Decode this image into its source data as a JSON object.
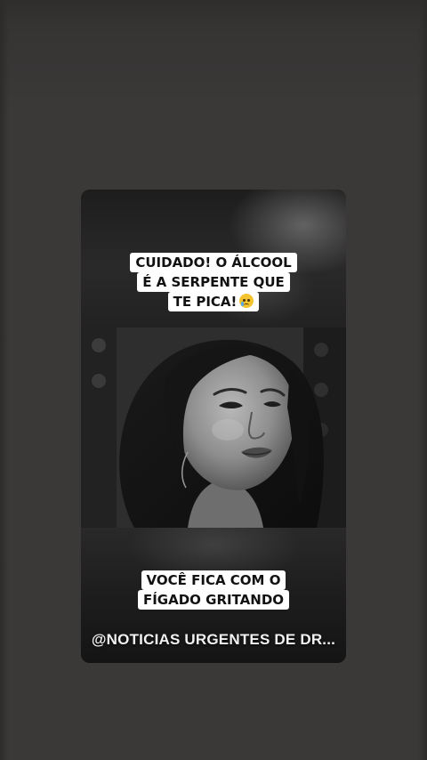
{
  "story": {
    "caption_top": {
      "lines": [
        "CUIDADO! O ÁLCOOL",
        "É A SERPENTE QUE",
        "TE PICA!"
      ],
      "emoji": "sad-tear-face-emoji"
    },
    "caption_bottom": {
      "lines": [
        "VOCÊ FICA COM O",
        "FÍGADO GRITANDO"
      ]
    },
    "watermark": "@NOTICIAS URGENTES DE DR..."
  },
  "colors": {
    "background": "#3b3938",
    "caption_bg": "#ffffff",
    "caption_text": "#111111",
    "watermark_text": "#f2f2f2"
  }
}
